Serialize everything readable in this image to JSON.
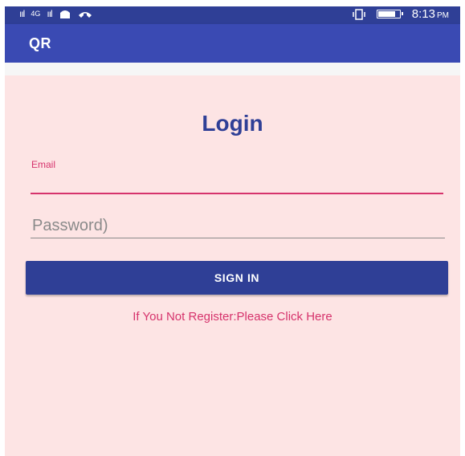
{
  "status_bar": {
    "signal_1": "ııl",
    "network": "4G",
    "signal_2": "ııl",
    "time": "8:13",
    "ampm": "PM",
    "icons": [
      "signal-icon",
      "signal-icon",
      "notification-icon",
      "missed-call-icon",
      "vibrate-icon",
      "battery-icon"
    ]
  },
  "app_bar": {
    "title": "QR"
  },
  "login": {
    "title": "Login",
    "email_label": "Email",
    "email_value": "",
    "password_placeholder": "Password)",
    "signin_label": "SIGN IN",
    "register_link": "If You Not Register:Please Click Here"
  },
  "colors": {
    "primary": "#3a4ab3",
    "primary_dark": "#2f3f96",
    "accent": "#d6336c",
    "background": "#fde4e4"
  }
}
